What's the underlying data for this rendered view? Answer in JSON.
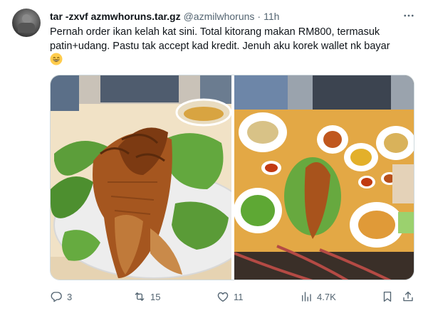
{
  "tweet": {
    "display_name": "tar -zxvf azmwhoruns.tar.gz",
    "handle": "@azmilwhoruns",
    "separator": "·",
    "time": "11h",
    "text": "Pernah order ikan kelah kat sini. Total kitorang makan RM800, termasuk patin+udang. Pastu tak accept kad kredit. Jenuh aku korek wallet nk bayar",
    "emoji": "grinning-face-with-smiling-eyes",
    "media": [
      {
        "subject": "fried-fish-on-lettuce"
      },
      {
        "subject": "table-of-dishes"
      }
    ]
  },
  "actions": {
    "replies": "3",
    "reposts": "15",
    "likes": "11",
    "views": "4.7K"
  },
  "icons": {
    "more": "more-options-icon",
    "reply": "reply-icon",
    "repost": "repost-icon",
    "like": "like-icon",
    "views": "views-icon",
    "bookmark": "bookmark-icon",
    "share": "share-icon"
  },
  "colors": {
    "text": "#0f1419",
    "secondary": "#536471",
    "border": "#cfd9de"
  }
}
